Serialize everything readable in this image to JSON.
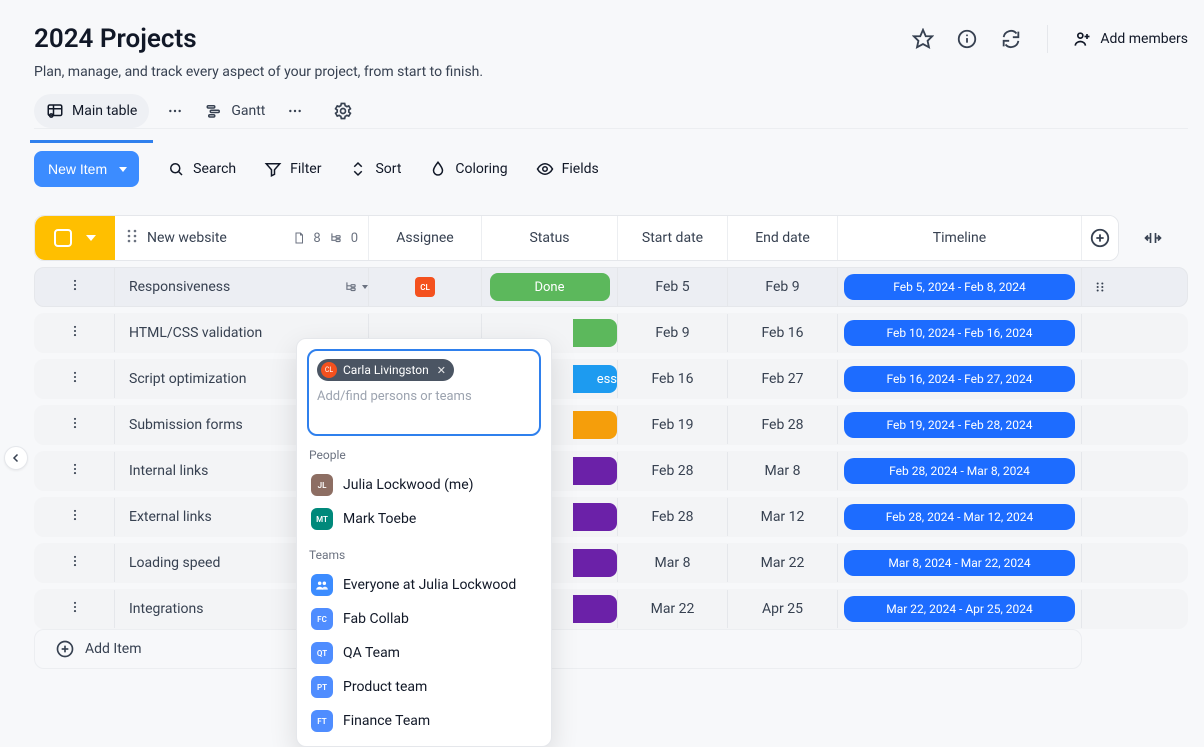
{
  "header": {
    "title": "2024 Projects",
    "subtitle": "Plan, manage, and track every aspect of your project, from start to finish.",
    "add_members": "Add members"
  },
  "tabs": {
    "main_table": "Main table",
    "gantt": "Gantt"
  },
  "toolbar": {
    "new_item": "New Item",
    "search": "Search",
    "filter": "Filter",
    "sort": "Sort",
    "coloring": "Coloring",
    "fields": "Fields"
  },
  "columns": {
    "group_name": "New website",
    "group_count_docs": "8",
    "group_count_sub": "0",
    "assignee": "Assignee",
    "status": "Status",
    "start_date": "Start date",
    "end_date": "End date",
    "timeline": "Timeline"
  },
  "status_labels": {
    "done": "Done",
    "ess": "ess"
  },
  "rows": [
    {
      "name": "Responsiveness",
      "assignee": "CL",
      "assignee_bg": "cl",
      "status_text": "Done",
      "status_color": "#5cb85c",
      "stub": false,
      "start": "Feb 5",
      "end": "Feb 9",
      "timeline": "Feb 5, 2024 - Feb 8, 2024",
      "highlight": true,
      "drag": true,
      "subicon": true
    },
    {
      "name": "HTML/CSS validation",
      "status_color": "#5cb85c",
      "stub": true,
      "start": "Feb 9",
      "end": "Feb 16",
      "timeline": "Feb 10, 2024 - Feb 16, 2024"
    },
    {
      "name": "Script optimization",
      "status_text": "ess",
      "status_color": "#1d9bf0",
      "stub": true,
      "start": "Feb 16",
      "end": "Feb 27",
      "timeline": "Feb 16, 2024 - Feb 27, 2024"
    },
    {
      "name": "Submission forms",
      "status_color": "#f59e0b",
      "stub": true,
      "start": "Feb 19",
      "end": "Feb 28",
      "timeline": "Feb 19, 2024 - Feb 28, 2024"
    },
    {
      "name": "Internal links",
      "status_color": "#6b21a8",
      "stub": true,
      "start": "Feb 28",
      "end": "Mar 8",
      "timeline": "Feb 28, 2024 - Mar 8, 2024"
    },
    {
      "name": "External links",
      "status_color": "#6b21a8",
      "stub": true,
      "start": "Feb 28",
      "end": "Mar 12",
      "timeline": "Feb 28, 2024 - Mar 12, 2024"
    },
    {
      "name": "Loading speed",
      "status_color": "#6b21a8",
      "stub": true,
      "start": "Mar 8",
      "end": "Mar 22",
      "timeline": "Mar 8, 2024 - Mar 22, 2024"
    },
    {
      "name": "Integrations",
      "status_color": "#6b21a8",
      "stub": true,
      "start": "Mar 22",
      "end": "Apr 25",
      "timeline": "Mar 22, 2024 - Apr 25, 2024"
    }
  ],
  "add_item": "Add Item",
  "popover": {
    "chip_name": "Carla Livingston",
    "placeholder": "Add/find persons or teams",
    "people_label": "People",
    "teams_label": "Teams",
    "people": [
      {
        "initials": "JL",
        "cls": "jl",
        "label": "Julia Lockwood (me)"
      },
      {
        "initials": "MT",
        "cls": "mt",
        "label": "Mark Toebe"
      }
    ],
    "teams": [
      {
        "initials": "",
        "cls": "ev",
        "label": "Everyone at Julia Lockwood",
        "icon": true
      },
      {
        "initials": "FC",
        "cls": "fc",
        "label": "Fab Collab"
      },
      {
        "initials": "QT",
        "cls": "qt",
        "label": "QA Team"
      },
      {
        "initials": "PT",
        "cls": "pt",
        "label": "Product team"
      },
      {
        "initials": "FT",
        "cls": "ft",
        "label": "Finance Team"
      }
    ]
  }
}
